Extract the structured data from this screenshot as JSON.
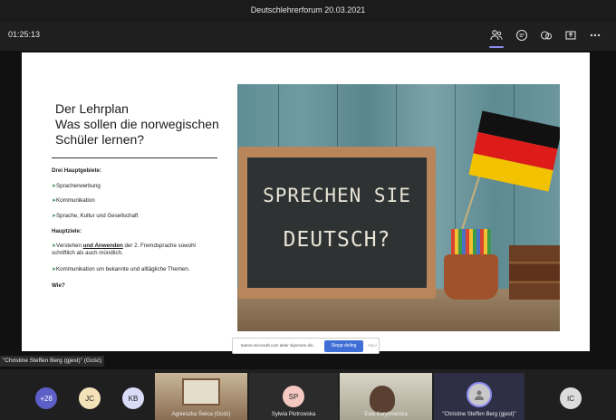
{
  "window": {
    "title": "Deutschlehrerforum 20.03.2021"
  },
  "toolbar": {
    "timer": "01:25:13",
    "icons": [
      "participants-icon",
      "chat-icon",
      "rooms-icon",
      "share-tray-icon",
      "more-icon"
    ]
  },
  "slide": {
    "title_line1": "Der Lehrplan",
    "title_line2": "Was sollen die norwegischen",
    "title_line3": "Schüler lernen?",
    "section1": "Drei Hauptgebiete:",
    "items1": [
      "Spracherwerbung",
      "Kommunikation",
      "Sprache, Kultur und Gesellschaft"
    ],
    "section2": "Hauptziele:",
    "goal1_pre": "Verstehen ",
    "goal1_em": "und Anwenden",
    "goal1_post": " der 2. Fremdsprache sowohl",
    "goal1_line2": "schriftlich als auch mündlich.",
    "goal2": "Kommunikation um bekannte und alltägliche Themen.",
    "section3": "Wie?",
    "board_line1": "SPRECHEN SIE",
    "board_line2": "DEUTSCH?",
    "flag_colors": [
      "#111111",
      "#dd1c1a",
      "#f2c200"
    ]
  },
  "sharebar": {
    "url": "teams.microsoft.com deler skjermen din.",
    "stop_label": "Stopp deling",
    "hide_label": "Skjul"
  },
  "presenter_label": "\"Christine Steffen Berg (gjest)\" (Gość)",
  "gallery": {
    "overflow": "+28",
    "avatars": [
      {
        "initials": "JC",
        "color": "#f3e2b8"
      },
      {
        "initials": "KB",
        "color": "#d9dbf7"
      },
      {
        "initials": "SP",
        "color": "#f5c9c2"
      },
      {
        "initials": "IC",
        "color": "#dcdcdc"
      }
    ],
    "tiles": [
      {
        "name": "Agnieszka Świca (Gość)"
      },
      {
        "name": "Sylwia Piotrowska"
      },
      {
        "name": "Ewa Korytkowska"
      },
      {
        "name": "\"Christine Steffen Berg (gjest)\""
      }
    ]
  }
}
